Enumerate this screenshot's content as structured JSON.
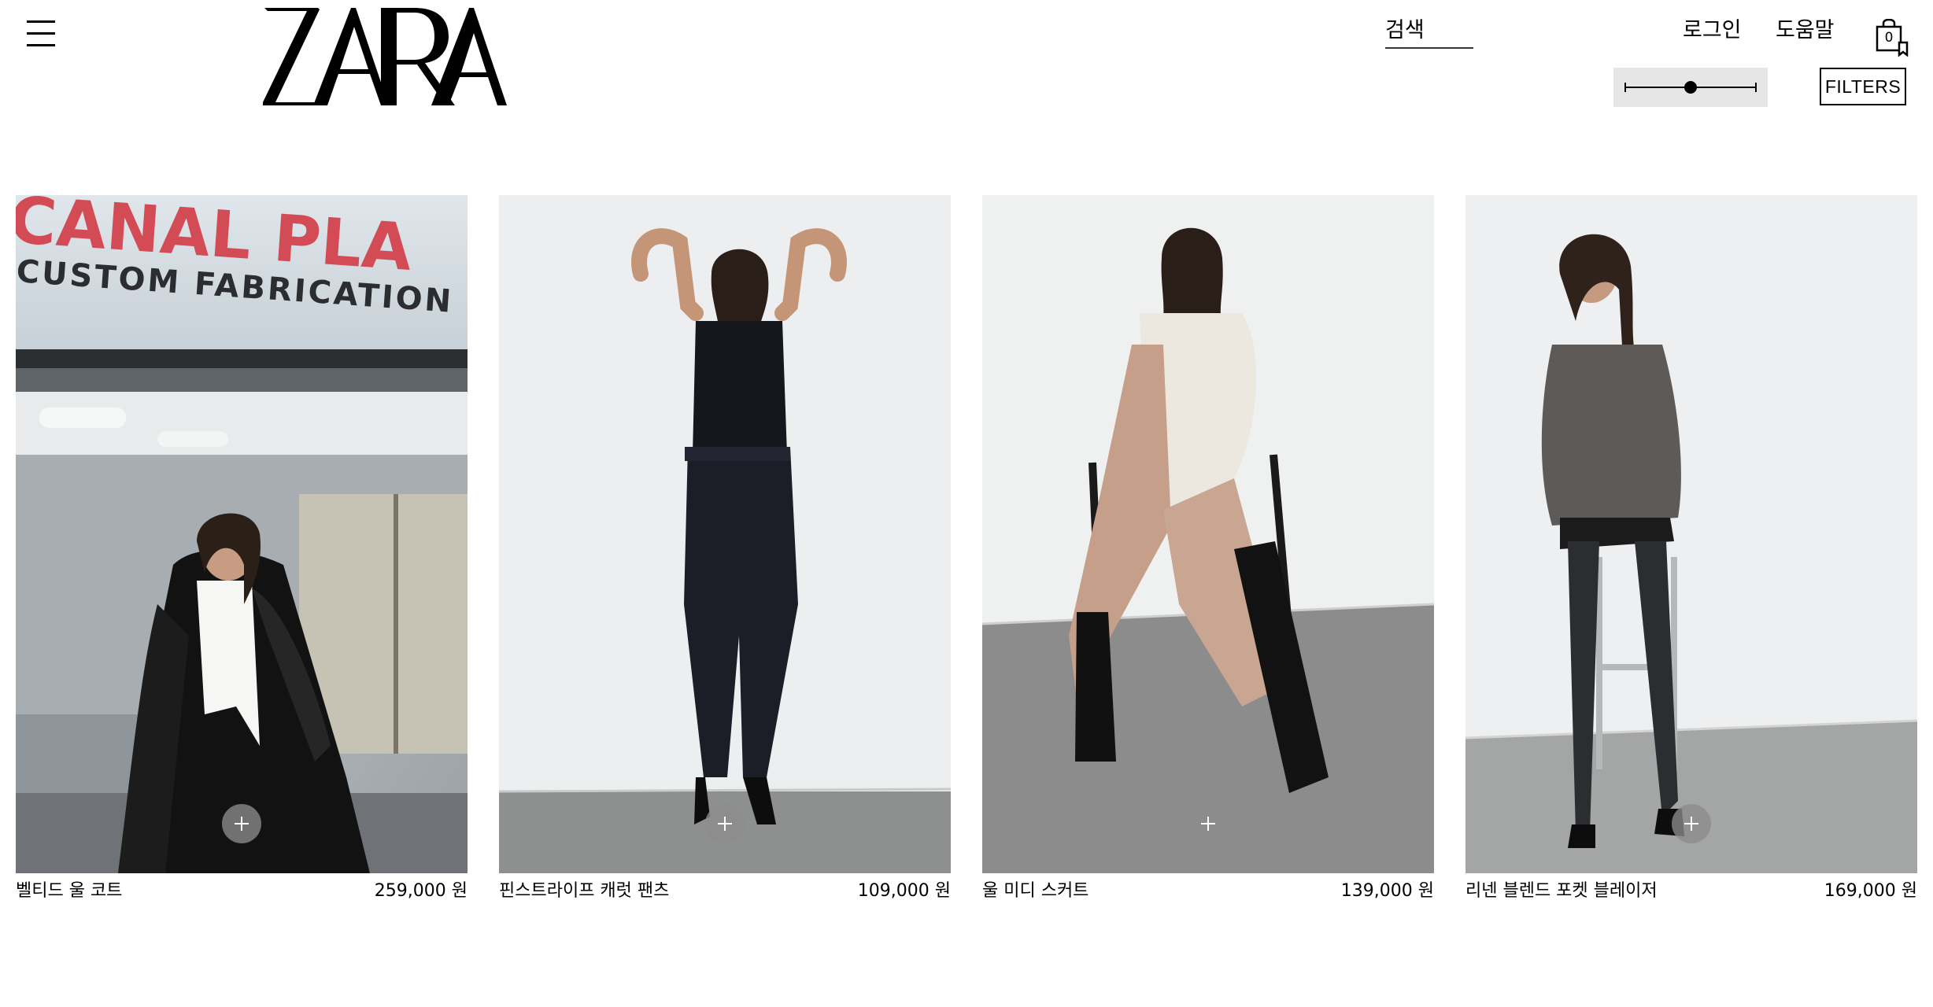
{
  "header": {
    "brand": "ZARA",
    "search_label": "검색",
    "login_label": "로그인",
    "help_label": "도움말",
    "cart_count": "0",
    "filters_label": "FILTERS",
    "zoom_level": 0.5
  },
  "products": [
    {
      "name": "벨티드 울 코트",
      "price": "259,000 원",
      "image": "woman-black-wool-coat-white-shirt",
      "sign_text_1": "CANAL PLA",
      "sign_text_2": "CUSTOM FABRICATION"
    },
    {
      "name": "핀스트라이프 캐럿 팬츠",
      "price": "109,000 원",
      "image": "woman-navy-pinstripe-jumpsuit-look"
    },
    {
      "name": "울 미디 스커트",
      "price": "139,000 원",
      "image": "woman-seated-camel-skirt-black-boots"
    },
    {
      "name": "리넨 블렌드 포켓 블레이저",
      "price": "169,000 원",
      "image": "woman-grey-blazer-black-tights-stool"
    }
  ],
  "colors": {
    "text": "#000000",
    "background": "#ffffff",
    "add_button": "#8c8c8c"
  }
}
